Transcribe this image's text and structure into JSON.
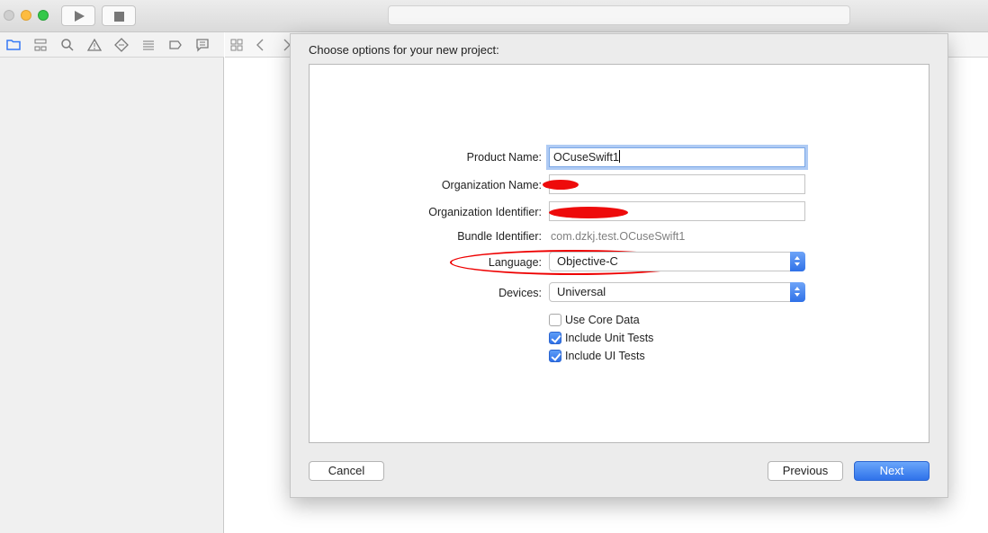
{
  "window": {
    "activity_text": ""
  },
  "navigator": {
    "icons": [
      "folder-icon",
      "hierarchy-icon",
      "search-icon",
      "warning-icon",
      "test-diamond-icon",
      "debug-list-icon",
      "breakpoint-icon",
      "report-icon"
    ]
  },
  "sheet": {
    "title": "Choose options for your new project:",
    "fields": {
      "product_name": {
        "label": "Product Name:",
        "value": "OCuseSwift1"
      },
      "organization_name": {
        "label": "Organization Name:",
        "value": ""
      },
      "organization_identifier": {
        "label": "Organization Identifier:",
        "value": ""
      },
      "bundle_identifier": {
        "label": "Bundle Identifier:",
        "value": "com.dzkj.test.OCuseSwift1"
      },
      "language": {
        "label": "Language:",
        "value": "Objective-C"
      },
      "devices": {
        "label": "Devices:",
        "value": "Universal"
      }
    },
    "checkboxes": [
      {
        "label": "Use Core Data",
        "checked": false
      },
      {
        "label": "Include Unit Tests",
        "checked": true
      },
      {
        "label": "Include UI Tests",
        "checked": true
      }
    ],
    "buttons": {
      "cancel": "Cancel",
      "previous": "Previous",
      "next": "Next"
    }
  },
  "colors": {
    "accent": "#2f71e8",
    "annotation_red": "#ee0b0b"
  }
}
